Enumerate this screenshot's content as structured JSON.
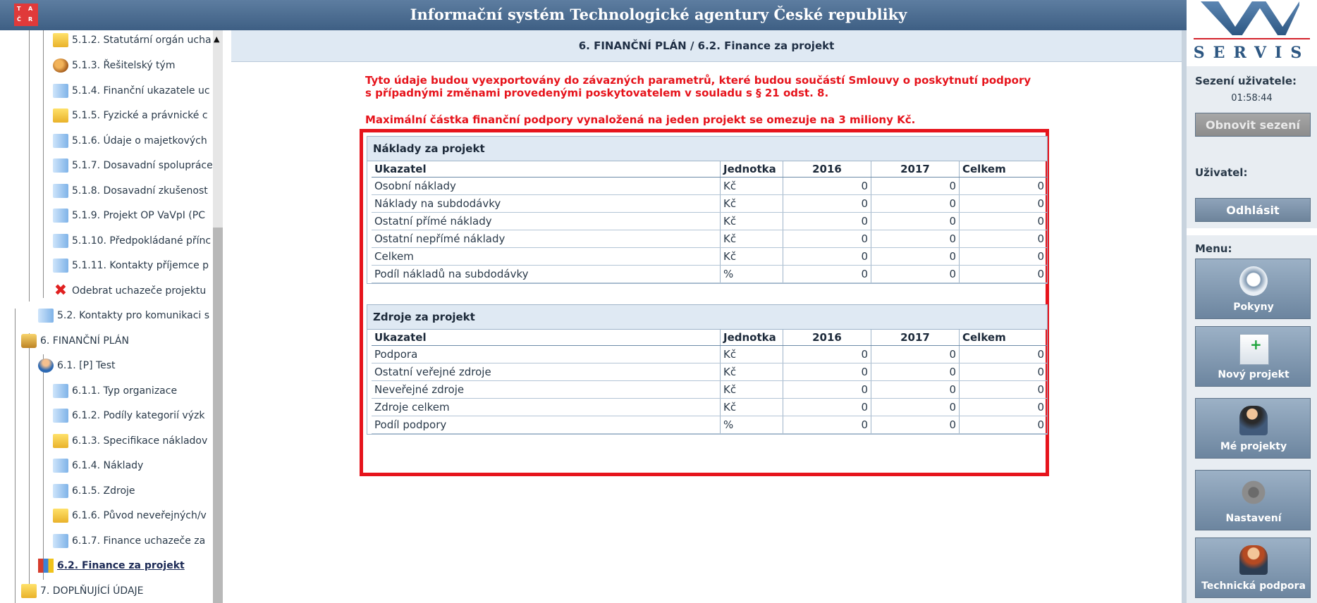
{
  "app": {
    "title": "Informační systém Technologické agentury České republiky",
    "logo_letters": [
      "T",
      "A",
      "Č",
      "R"
    ]
  },
  "sidebar": {
    "items": [
      {
        "label": "5.1.2. Statutární orgán ucha",
        "icon": "folder-icon"
      },
      {
        "label": "5.1.3. Řešitelský tým",
        "icon": "team-icon"
      },
      {
        "label": "5.1.4. Finanční ukazatele uc",
        "icon": "document-icon"
      },
      {
        "label": "5.1.5. Fyzické a právnické c",
        "icon": "folder-icon"
      },
      {
        "label": "5.1.6. Údaje o majetkových",
        "icon": "document-icon"
      },
      {
        "label": "5.1.7. Dosavadní spolupráce",
        "icon": "document-icon"
      },
      {
        "label": "5.1.8. Dosavadní zkušenost",
        "icon": "document-icon"
      },
      {
        "label": "5.1.9. Projekt OP VaVpI (PC",
        "icon": "document-icon"
      },
      {
        "label": "5.1.10. Předpokládané přínc",
        "icon": "document-icon"
      },
      {
        "label": "5.1.11. Kontakty příjemce p",
        "icon": "document-icon"
      },
      {
        "label": "Odebrat uchazeče projektu",
        "icon": "remove-icon"
      },
      {
        "label": "5.2. Kontakty pro komunikaci s",
        "icon": "document-icon"
      },
      {
        "label": "6. FINANČNÍ PLÁN",
        "icon": "money-icon"
      },
      {
        "label": "6.1. [P] Test",
        "icon": "user-icon"
      },
      {
        "label": "6.1.1. Typ organizace",
        "icon": "document-icon"
      },
      {
        "label": "6.1.2. Podíly kategorií výzk",
        "icon": "document-icon"
      },
      {
        "label": "6.1.3. Specifikace nákladov",
        "icon": "folder-icon"
      },
      {
        "label": "6.1.4. Náklady",
        "icon": "document-icon"
      },
      {
        "label": "6.1.5. Zdroje",
        "icon": "document-icon"
      },
      {
        "label": "6.1.6. Původ neveřejných/v",
        "icon": "folder-icon"
      },
      {
        "label": "6.1.7. Finance uchazeče za",
        "icon": "document-icon"
      },
      {
        "label": "6.2. Finance za projekt",
        "icon": "chart-icon"
      },
      {
        "label": "7. DOPLŇUJÍCÍ ÚDAJE",
        "icon": "folder-icon"
      }
    ]
  },
  "main": {
    "header": "6. FINANČNÍ PLÁN / 6.2. Finance za projekt",
    "notice1_line1": "Tyto údaje budou vyexportovány do závazných parametrů, které budou součástí Smlouvy o poskytnutí podpory",
    "notice1_line2": "s případnými změnami provedenými poskytovatelem v souladu s § 21 odst. 8.",
    "notice2": "Maximální částka finanční podpory vynaložená na jeden projekt se omezuje na 3 miliony Kč.",
    "costs": {
      "title": "Náklady za projekt",
      "columns": [
        "Ukazatel",
        "Jednotka",
        "2016",
        "2017",
        "Celkem"
      ],
      "rows": [
        [
          "Osobní náklady",
          "Kč",
          "0",
          "0",
          "0"
        ],
        [
          "Náklady na subdodávky",
          "Kč",
          "0",
          "0",
          "0"
        ],
        [
          "Ostatní přímé náklady",
          "Kč",
          "0",
          "0",
          "0"
        ],
        [
          "Ostatní nepřímé náklady",
          "Kč",
          "0",
          "0",
          "0"
        ],
        [
          "Celkem",
          "Kč",
          "0",
          "0",
          "0"
        ],
        [
          "Podíl nákladů na subdodávky",
          "%",
          "0",
          "0",
          "0"
        ]
      ]
    },
    "sources": {
      "title": "Zdroje za projekt",
      "columns": [
        "Ukazatel",
        "Jednotka",
        "2016",
        "2017",
        "Celkem"
      ],
      "rows": [
        [
          "Podpora",
          "Kč",
          "0",
          "0",
          "0"
        ],
        [
          "Ostatní veřejné zdroje",
          "Kč",
          "0",
          "0",
          "0"
        ],
        [
          "Neveřejné zdroje",
          "Kč",
          "0",
          "0",
          "0"
        ],
        [
          "Zdroje celkem",
          "Kč",
          "0",
          "0",
          "0"
        ],
        [
          "Podíl podpory",
          "%",
          "0",
          "0",
          "0"
        ]
      ]
    }
  },
  "right": {
    "brand": "SERVIS",
    "session_label": "Sezení uživatele:",
    "session_time": "01:58:44",
    "renew_button": "Obnovit sezení",
    "user_label": "Uživatel:",
    "logout_button": "Odhlásit",
    "menu_label": "Menu:",
    "menu": [
      {
        "label": "Pokyny",
        "icon": "info-icon"
      },
      {
        "label": "Nový projekt",
        "icon": "new-project-icon"
      },
      {
        "label": "Mé projekty",
        "icon": "my-projects-icon"
      },
      {
        "label": "Nastavení",
        "icon": "settings-gear-icon"
      },
      {
        "label": "Technická podpora",
        "icon": "support-icon"
      }
    ]
  }
}
